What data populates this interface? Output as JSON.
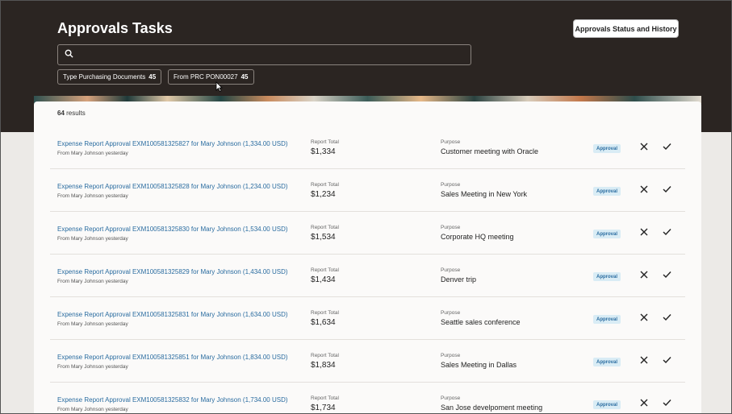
{
  "header": {
    "title": "Approvals Tasks",
    "status_button": "Approvals Status and History"
  },
  "search": {
    "placeholder": "",
    "value": ""
  },
  "filters": [
    {
      "label": "Type Purchasing Documents",
      "count": "45"
    },
    {
      "label": "From PRC PON00027",
      "count": "45"
    }
  ],
  "results": {
    "count": "64",
    "label": "results"
  },
  "tasks": [
    {
      "title": "Expense Report Approval EXM100581325827 for Mary Johnson (1,334.00 USD)",
      "from": "From Mary Johnson yesterday",
      "total_label": "Report Total",
      "total": "$1,334",
      "purpose_label": "Purpose",
      "purpose": "Customer meeting with Oracle",
      "badge": "Approval"
    },
    {
      "title": "Expense Report Approval EXM100581325828 for Mary Johnson (1,234.00 USD)",
      "from": "From Mary Johnson yesterday",
      "total_label": "Report Total",
      "total": "$1,234",
      "purpose_label": "Purpose",
      "purpose": "Sales Meeting in New York",
      "badge": "Approval"
    },
    {
      "title": "Expense Report Approval EXM100581325830 for Mary Johnson (1,534.00 USD)",
      "from": "From Mary Johnson yesterday",
      "total_label": "Report Total",
      "total": "$1,534",
      "purpose_label": "Purpose",
      "purpose": "Corporate HQ meeting",
      "badge": "Approval"
    },
    {
      "title": "Expense Report Approval EXM100581325829 for Mary Johnson (1,434.00 USD)",
      "from": "From Mary Johnson yesterday",
      "total_label": "Report Total",
      "total": "$1,434",
      "purpose_label": "Purpose",
      "purpose": "Denver trip",
      "badge": "Approval"
    },
    {
      "title": "Expense Report Approval EXM100581325831 for Mary Johnson (1,634.00 USD)",
      "from": "From Mary Johnson yesterday",
      "total_label": "Report Total",
      "total": "$1,634",
      "purpose_label": "Purpose",
      "purpose": "Seattle sales conference",
      "badge": "Approval"
    },
    {
      "title": "Expense Report Approval EXM100581325851 for Mary Johnson (1,834.00 USD)",
      "from": "From Mary Johnson yesterday",
      "total_label": "Report Total",
      "total": "$1,834",
      "purpose_label": "Purpose",
      "purpose": "Sales Meeting in Dallas",
      "badge": "Approval"
    },
    {
      "title": "Expense Report Approval EXM100581325832 for Mary Johnson (1,734.00 USD)",
      "from": "From Mary Johnson yesterday",
      "total_label": "Report Total",
      "total": "$1,734",
      "purpose_label": "Purpose",
      "purpose": "San Jose develpoment meeting",
      "badge": "Approval"
    }
  ],
  "icons": {
    "search": "search-icon",
    "reject": "close-icon",
    "approve": "checkmark-icon",
    "pointer": "mouse-pointer-icon"
  },
  "colors": {
    "header_bg": "#2b2522",
    "link": "#2a6ca0",
    "badge_bg": "#d9ecf5",
    "panel_bg": "#fbfaf9"
  }
}
